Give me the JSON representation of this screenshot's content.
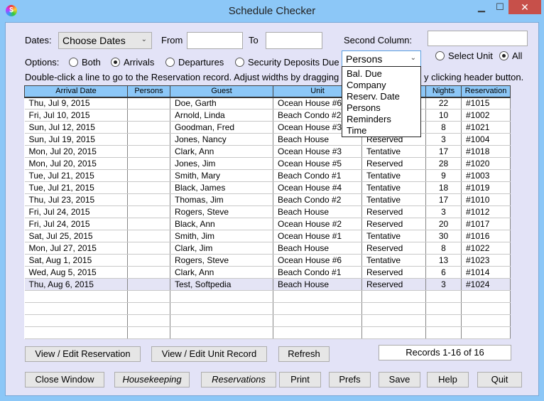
{
  "window": {
    "title": "Schedule Checker",
    "icon": "app-icon",
    "minimize": "▁",
    "maximize": "☐",
    "close": "✕"
  },
  "filters": {
    "dates_label": "Dates:",
    "dates_value": "Choose Dates",
    "from_label": "From",
    "from_value": "",
    "to_label": "To",
    "to_value": "",
    "second_column_label": "Second Column:",
    "second_column_input": "",
    "second_column_value": "Persons",
    "options_label": "Options:",
    "options": [
      {
        "label": "Both",
        "checked": false
      },
      {
        "label": "Arrivals",
        "checked": true
      },
      {
        "label": "Departures",
        "checked": false
      },
      {
        "label": "Security Deposits Due",
        "checked": false
      }
    ],
    "unit_options": [
      {
        "label": "Select Unit",
        "checked": false
      },
      {
        "label": "All",
        "checked": true
      }
    ]
  },
  "dropdown": {
    "items": [
      "Bal. Due",
      "Company",
      "Reserv. Date",
      "Persons",
      "Reminders",
      "Time"
    ]
  },
  "instructions": "Double-click a line to go to the Reservation record. Adjust widths by dragging betw",
  "instructions_tail": "y clicking header button.",
  "table": {
    "columns": [
      "Arrival Date",
      "Persons",
      "Guest",
      "Unit",
      "",
      "Nights",
      "Reservation"
    ],
    "rows": [
      [
        "Thu, Jul 9, 2015",
        "",
        "Doe, Garth",
        "Ocean House #6",
        "",
        "22",
        "#1015"
      ],
      [
        "Fri, Jul 10, 2015",
        "",
        "Arnold, Linda",
        "Beach Condo #2",
        "",
        "10",
        "#1002"
      ],
      [
        "Sun, Jul 12, 2015",
        "",
        "Goodman, Fred",
        "Ocean House #3",
        "",
        "8",
        "#1021"
      ],
      [
        "Sun, Jul 19, 2015",
        "",
        "Jones, Nancy",
        "Beach House",
        "Reserved",
        "3",
        "#1004"
      ],
      [
        "Mon, Jul 20, 2015",
        "",
        "Clark, Ann",
        "Ocean House #3",
        "Tentative",
        "17",
        "#1018"
      ],
      [
        "Mon, Jul 20, 2015",
        "",
        "Jones, Jim",
        "Ocean House #5",
        "Reserved",
        "28",
        "#1020"
      ],
      [
        "Tue, Jul 21, 2015",
        "",
        "Smith, Mary",
        "Beach Condo #1",
        "Tentative",
        "9",
        "#1003"
      ],
      [
        "Tue, Jul 21, 2015",
        "",
        "Black, James",
        "Ocean House #4",
        "Tentative",
        "18",
        "#1019"
      ],
      [
        "Thu, Jul 23, 2015",
        "",
        "Thomas, Jim",
        "Beach Condo #2",
        "Tentative",
        "17",
        "#1010"
      ],
      [
        "Fri, Jul 24, 2015",
        "",
        "Rogers, Steve",
        "Beach House",
        "Reserved",
        "3",
        "#1012"
      ],
      [
        "Fri, Jul 24, 2015",
        "",
        "Black, Ann",
        "Ocean House #2",
        "Reserved",
        "20",
        "#1017"
      ],
      [
        "Sat, Jul 25, 2015",
        "",
        "Smith, Jim",
        "Ocean House #1",
        "Tentative",
        "30",
        "#1016"
      ],
      [
        "Mon, Jul 27, 2015",
        "",
        "Clark, Jim",
        "Beach House",
        "Reserved",
        "8",
        "#1022"
      ],
      [
        "Sat, Aug 1, 2015",
        "",
        "Rogers, Steve",
        "Ocean House #6",
        "Tentative",
        "13",
        "#1023"
      ],
      [
        "Wed, Aug 5, 2015",
        "",
        "Clark, Ann",
        "Beach Condo #1",
        "Reserved",
        "6",
        "#1014"
      ],
      [
        "Thu, Aug 6, 2015",
        "",
        "Test, Softpedia",
        "Beach House",
        "Reserved",
        "3",
        "#1024"
      ]
    ],
    "empty_rows": 4,
    "selected_row": 15
  },
  "buttons": {
    "view_res": "View / Edit Reservation",
    "view_unit": "View / Edit Unit Record",
    "refresh": "Refresh",
    "records": "Records 1-16 of 16",
    "close": "Close Window",
    "housekeeping": "Housekeeping",
    "reservations": "Reservations",
    "print": "Print",
    "prefs": "Prefs",
    "save": "Save",
    "help": "Help",
    "quit": "Quit"
  }
}
